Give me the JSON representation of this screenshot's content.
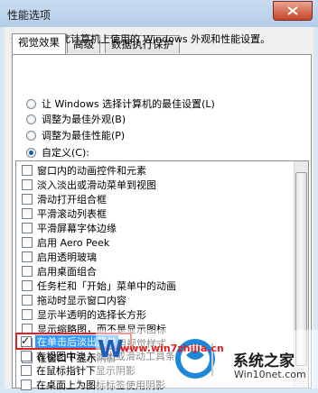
{
  "window": {
    "title": "性能选项"
  },
  "tabs": [
    {
      "label": "视觉效果",
      "active": true
    },
    {
      "label": "高级",
      "active": false
    },
    {
      "label": "数据执行保护",
      "active": false
    }
  ],
  "description": "选择您想在此计算机上使用的 Windows 外观和性能设置。",
  "radios": [
    {
      "label": "让 Windows 选择计算机的最佳设置(L)",
      "selected": false
    },
    {
      "label": "调整为最佳外观(B)",
      "selected": false
    },
    {
      "label": "调整为最佳性能(P)",
      "selected": false
    },
    {
      "label": "自定义(C):",
      "selected": true
    }
  ],
  "options": [
    {
      "label": "窗口内的动画控件和元素",
      "checked": false
    },
    {
      "label": "淡入淡出或滑动菜单到视图",
      "checked": false
    },
    {
      "label": "滑动打开组合框",
      "checked": false
    },
    {
      "label": "平滑滚动列表框",
      "checked": false
    },
    {
      "label": "平滑屏幕字体边缘",
      "checked": false
    },
    {
      "label": "启用 Aero Peek",
      "checked": false
    },
    {
      "label": "启用透明玻璃",
      "checked": false
    },
    {
      "label": "启用桌面组合",
      "checked": false
    },
    {
      "label": "任务栏和「开始」菜单中的动画",
      "checked": false
    },
    {
      "label": "拖动时显示窗口内容",
      "checked": false
    },
    {
      "label": "显示半透明的选择长方形",
      "checked": false
    },
    {
      "label": "显示缩略图，而不是显示图标",
      "checked": false
    },
    {
      "label": "在窗口和按钮上使用视觉样式",
      "checked": false
    },
    {
      "label": "在窗口下显示阴影",
      "checked": false
    },
    {
      "label": "在单击后淡出菜单",
      "checked": true,
      "selected": true
    },
    {
      "label": "在视图中淡入淡出或滑动工具条提示",
      "checked": false
    },
    {
      "label": "在鼠标指针下显示阴影",
      "checked": false
    },
    {
      "label": "在桌面上为图标标签使用阴影",
      "checked": false
    }
  ],
  "watermark": {
    "url": "www.win7zhijia.cn",
    "brand": "系统之家",
    "domain": "Win10net.com"
  },
  "colors": {
    "selection": "#3399ff",
    "highlight_box": "#e02020",
    "titlebar": "#c9dcf0"
  }
}
